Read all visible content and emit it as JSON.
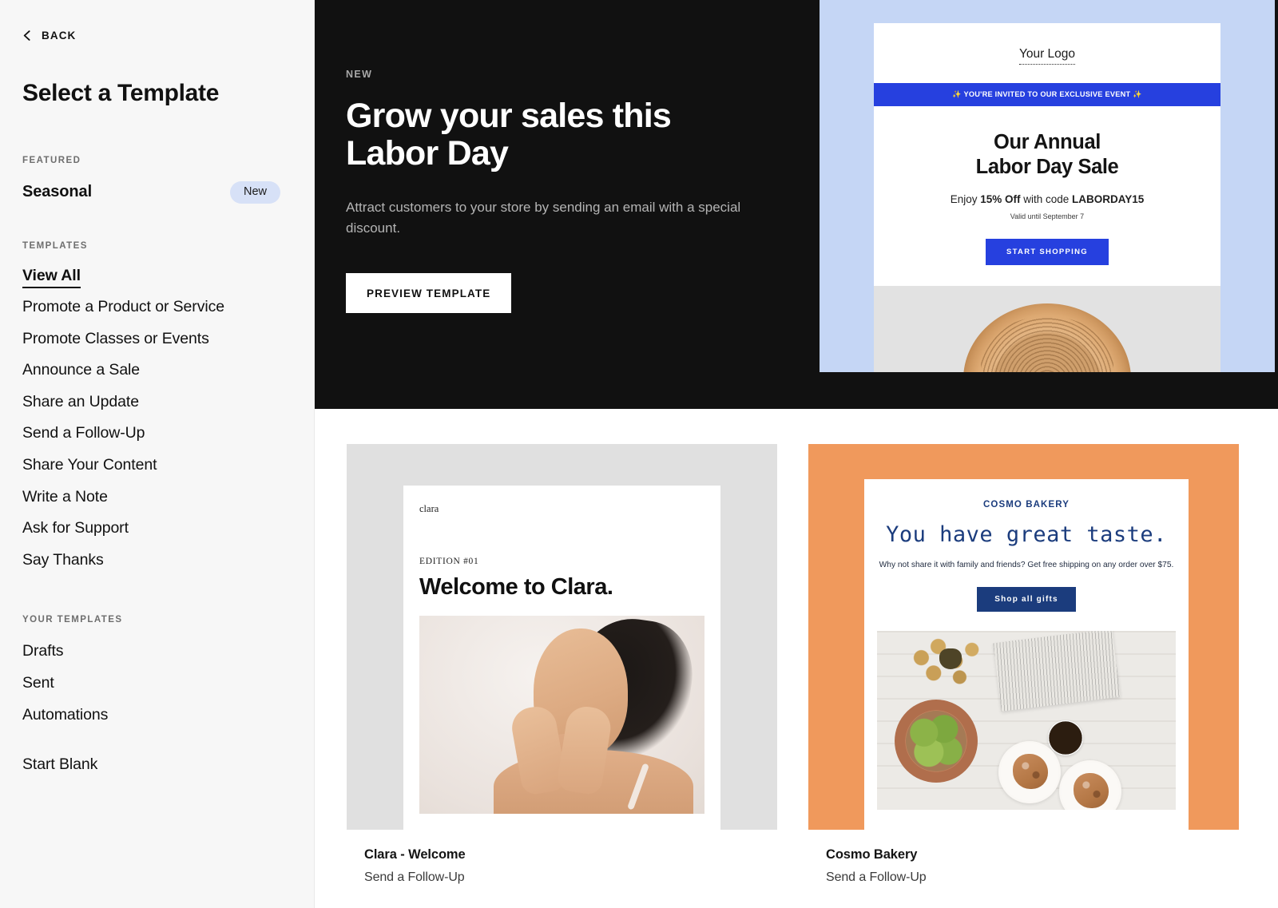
{
  "sidebar": {
    "back_label": "BACK",
    "title": "Select a Template",
    "featured_label": "FEATURED",
    "featured_item": {
      "label": "Seasonal",
      "badge": "New"
    },
    "templates_label": "TEMPLATES",
    "template_items": [
      {
        "label": "View All",
        "active": true
      },
      {
        "label": "Promote a Product or Service",
        "active": false
      },
      {
        "label": "Promote Classes or Events",
        "active": false
      },
      {
        "label": "Announce a Sale",
        "active": false
      },
      {
        "label": "Share an Update",
        "active": false
      },
      {
        "label": "Send a Follow-Up",
        "active": false
      },
      {
        "label": "Share Your Content",
        "active": false
      },
      {
        "label": "Write a Note",
        "active": false
      },
      {
        "label": "Ask for Support",
        "active": false
      },
      {
        "label": "Say Thanks",
        "active": false
      }
    ],
    "your_templates_label": "YOUR TEMPLATES",
    "your_template_items": [
      {
        "label": "Drafts"
      },
      {
        "label": "Sent"
      },
      {
        "label": "Automations"
      }
    ],
    "start_blank": "Start Blank"
  },
  "hero": {
    "eyebrow": "NEW",
    "title": "Grow your sales this Labor Day",
    "subtitle": "Attract customers to your store by sending an email with a special discount.",
    "cta": "PREVIEW TEMPLATE",
    "background": "#111111",
    "preview": {
      "panel_color": "#c5d6f5",
      "logo": "Your Logo",
      "banner": "✨ YOU'RE INVITED TO OUR EXCLUSIVE EVENT ✨",
      "banner_color": "#2640df",
      "headline_line1": "Our Annual",
      "headline_line2": "Labor Day Sale",
      "offer_prefix": "Enjoy ",
      "offer_bold": "15% Off",
      "offer_mid": " with code ",
      "offer_code": "LABORDAY15",
      "valid": "Valid until September 7",
      "cta": "START SHOPPING",
      "photo_alt": "straw-sun-hat-photo"
    }
  },
  "grid": {
    "cards": [
      {
        "name": "Clara - Welcome",
        "category": "Send a Follow-Up",
        "frame_color": "#e0e0e0",
        "email": {
          "logo": "clara",
          "edition": "EDITION #01",
          "headline": "Welcome to Clara.",
          "photo_alt": "smiling-woman-skincare-photo"
        }
      },
      {
        "name": "Cosmo Bakery",
        "category": "Send a Follow-Up",
        "frame_color": "#f0995c",
        "email": {
          "brand": "COSMO BAKERY",
          "headline": "You have great taste.",
          "subtitle": "Why not share it with family and friends? Get free shipping on any order over $75.",
          "cta": "Shop all gifts",
          "accent_color": "#1b3c7d",
          "photo_alt": "flatlay-limes-pastries-coffee-photo"
        }
      }
    ]
  }
}
